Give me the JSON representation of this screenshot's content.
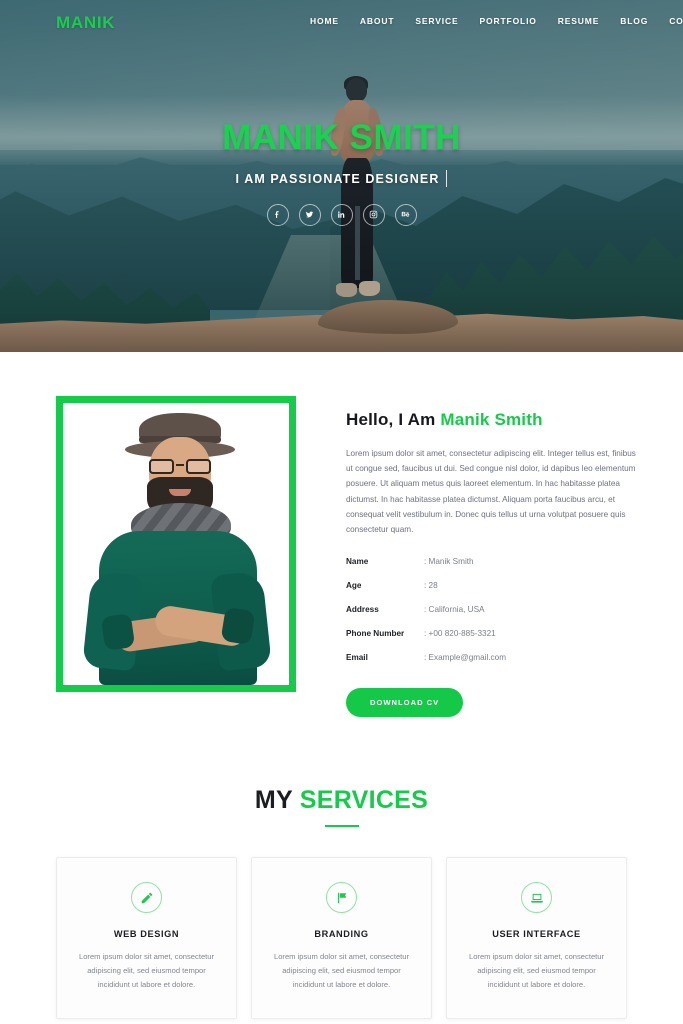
{
  "nav": {
    "logo": "MANIK",
    "items": [
      {
        "label": "HOME"
      },
      {
        "label": "ABOUT"
      },
      {
        "label": "SERVICE"
      },
      {
        "label": "PORTFOLIO"
      },
      {
        "label": "RESUME"
      },
      {
        "label": "BLOG"
      },
      {
        "label": "CONTACT"
      }
    ]
  },
  "hero": {
    "title": "MANIK SMITH",
    "subtitle": "I AM PASSIONATE DESIGNER",
    "socials": [
      {
        "name": "facebook-icon",
        "glyph": "f"
      },
      {
        "name": "twitter-icon",
        "glyph": "t"
      },
      {
        "name": "linkedin-icon",
        "glyph": "in"
      },
      {
        "name": "instagram-icon",
        "glyph": "ig"
      },
      {
        "name": "behance-icon",
        "glyph": "Be"
      }
    ]
  },
  "about": {
    "heading_plain": "Hello, I Am ",
    "heading_accent": "Manik Smith",
    "paragraph": "Lorem ipsum dolor sit amet, consectetur adipiscing elit. Integer tellus est, finibus ut congue sed, faucibus ut dui. Sed congue nisl dolor, id dapibus leo elementum posuere. Ut aliquam metus quis laoreet elementum. In hac habitasse platea dictumst. In hac habitasse platea dictumst. Aliquam porta faucibus arcu, et consequat velit vestibulum in. Donec quis tellus ut urna volutpat posuere quis consectetur quam.",
    "info": [
      {
        "key": "Name",
        "value": ": Manik Smith"
      },
      {
        "key": "Age",
        "value": ": 28"
      },
      {
        "key": "Address",
        "value": ": California, USA"
      },
      {
        "key": "Phone Number",
        "value": ": +00 820-885-3321"
      },
      {
        "key": "Email",
        "value": ": Example@gmail.com"
      }
    ],
    "cv_button": "DOWNLOAD CV"
  },
  "services": {
    "title_plain": "MY ",
    "title_accent": "SERVICES",
    "cards": [
      {
        "icon": "pencil-icon",
        "title": "WEB DESIGN",
        "text": "Lorem ipsum dolor sit amet, consectetur adipiscing elit, sed eiusmod tempor incididunt ut labore et dolore."
      },
      {
        "icon": "flag-icon",
        "title": "BRANDING",
        "text": "Lorem ipsum dolor sit amet, consectetur adipiscing elit, sed eiusmod tempor incididunt ut labore et dolore."
      },
      {
        "icon": "laptop-icon",
        "title": "USER INTERFACE",
        "text": "Lorem ipsum dolor sit amet, consectetur adipiscing elit, sed eiusmod tempor incididunt ut labore et dolore."
      }
    ]
  },
  "colors": {
    "accent_green": "#15cc4a",
    "hero_overlay": "#1c424a",
    "heading_dark": "#1b1d22",
    "body_text": "#6d7280"
  }
}
